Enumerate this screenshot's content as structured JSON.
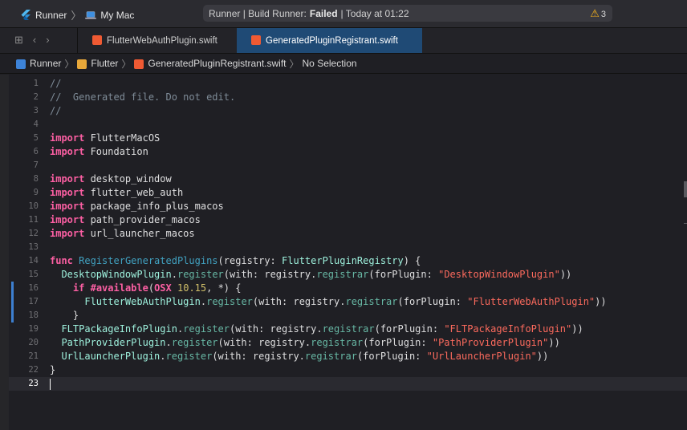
{
  "titlebar": {
    "scheme": "Runner",
    "destination": "My Mac",
    "status_prefix": "Runner | Build Runner:",
    "status_result": "Failed",
    "status_time": "| Today at 01:22",
    "warning_count": "3"
  },
  "tabs": [
    {
      "label": "FlutterWebAuthPlugin.swift",
      "active": false
    },
    {
      "label": "GeneratedPluginRegistrant.swift",
      "active": true
    }
  ],
  "jumpbar": {
    "items": [
      "Runner",
      "Flutter",
      "GeneratedPluginRegistrant.swift",
      "No Selection"
    ]
  },
  "colors": {
    "keyword": "#fc5fa3",
    "comment": "#7f8c98",
    "type": "#9ef1dd",
    "function_decl": "#41a1c0",
    "method": "#67b7a4",
    "string": "#fc6a5d",
    "number": "#d0bf69",
    "active_tab": "#1f4a75",
    "change_bar": "#3d7fd0",
    "warning": "#f6b21b"
  },
  "editor": {
    "current_line": 23,
    "changed_lines": [
      16,
      17,
      18
    ],
    "lines": [
      [
        [
          "cm",
          "//"
        ]
      ],
      [
        [
          "cm",
          "//  Generated file. Do not edit."
        ]
      ],
      [
        [
          "cm",
          "//"
        ]
      ],
      [],
      [
        [
          "kw",
          "import"
        ],
        [
          "pl",
          " FlutterMacOS"
        ]
      ],
      [
        [
          "kw",
          "import"
        ],
        [
          "pl",
          " Foundation"
        ]
      ],
      [],
      [
        [
          "kw",
          "import"
        ],
        [
          "pl",
          " desktop_window"
        ]
      ],
      [
        [
          "kw",
          "import"
        ],
        [
          "pl",
          " flutter_web_auth"
        ]
      ],
      [
        [
          "kw",
          "import"
        ],
        [
          "pl",
          " package_info_plus_macos"
        ]
      ],
      [
        [
          "kw",
          "import"
        ],
        [
          "pl",
          " path_provider_macos"
        ]
      ],
      [
        [
          "kw",
          "import"
        ],
        [
          "pl",
          " url_launcher_macos"
        ]
      ],
      [],
      [
        [
          "kw",
          "func"
        ],
        [
          "pl",
          " "
        ],
        [
          "fn",
          "RegisterGeneratedPlugins"
        ],
        [
          "pl",
          "(registry: "
        ],
        [
          "ty",
          "FlutterPluginRegistry"
        ],
        [
          "pl",
          ") {"
        ]
      ],
      [
        [
          "pl",
          "  "
        ],
        [
          "ty",
          "DesktopWindowPlugin"
        ],
        [
          "pl",
          "."
        ],
        [
          "mt",
          "register"
        ],
        [
          "pl",
          "(with: registry."
        ],
        [
          "mt",
          "registrar"
        ],
        [
          "pl",
          "(forPlugin: "
        ],
        [
          "st",
          "\"DesktopWindowPlugin\""
        ],
        [
          "pl",
          "))"
        ]
      ],
      [
        [
          "pl",
          "    "
        ],
        [
          "kw",
          "if"
        ],
        [
          "pl",
          " "
        ],
        [
          "kw",
          "#available"
        ],
        [
          "pl",
          "("
        ],
        [
          "kw",
          "OSX"
        ],
        [
          "pl",
          " "
        ],
        [
          "nu",
          "10.15"
        ],
        [
          "pl",
          ", *) {"
        ]
      ],
      [
        [
          "pl",
          "      "
        ],
        [
          "ty",
          "FlutterWebAuthPlugin"
        ],
        [
          "pl",
          "."
        ],
        [
          "mt",
          "register"
        ],
        [
          "pl",
          "(with: registry."
        ],
        [
          "mt",
          "registrar"
        ],
        [
          "pl",
          "(forPlugin: "
        ],
        [
          "st",
          "\"FlutterWebAuthPlugin\""
        ],
        [
          "pl",
          "))"
        ]
      ],
      [
        [
          "pl",
          "    }"
        ]
      ],
      [
        [
          "pl",
          "  "
        ],
        [
          "ty",
          "FLTPackageInfoPlugin"
        ],
        [
          "pl",
          "."
        ],
        [
          "mt",
          "register"
        ],
        [
          "pl",
          "(with: registry."
        ],
        [
          "mt",
          "registrar"
        ],
        [
          "pl",
          "(forPlugin: "
        ],
        [
          "st",
          "\"FLTPackageInfoPlugin\""
        ],
        [
          "pl",
          "))"
        ]
      ],
      [
        [
          "pl",
          "  "
        ],
        [
          "ty",
          "PathProviderPlugin"
        ],
        [
          "pl",
          "."
        ],
        [
          "mt",
          "register"
        ],
        [
          "pl",
          "(with: registry."
        ],
        [
          "mt",
          "registrar"
        ],
        [
          "pl",
          "(forPlugin: "
        ],
        [
          "st",
          "\"PathProviderPlugin\""
        ],
        [
          "pl",
          "))"
        ]
      ],
      [
        [
          "pl",
          "  "
        ],
        [
          "ty",
          "UrlLauncherPlugin"
        ],
        [
          "pl",
          "."
        ],
        [
          "mt",
          "register"
        ],
        [
          "pl",
          "(with: registry."
        ],
        [
          "mt",
          "registrar"
        ],
        [
          "pl",
          "(forPlugin: "
        ],
        [
          "st",
          "\"UrlLauncherPlugin\""
        ],
        [
          "pl",
          "))"
        ]
      ],
      [
        [
          "pl",
          "}"
        ]
      ],
      []
    ]
  }
}
